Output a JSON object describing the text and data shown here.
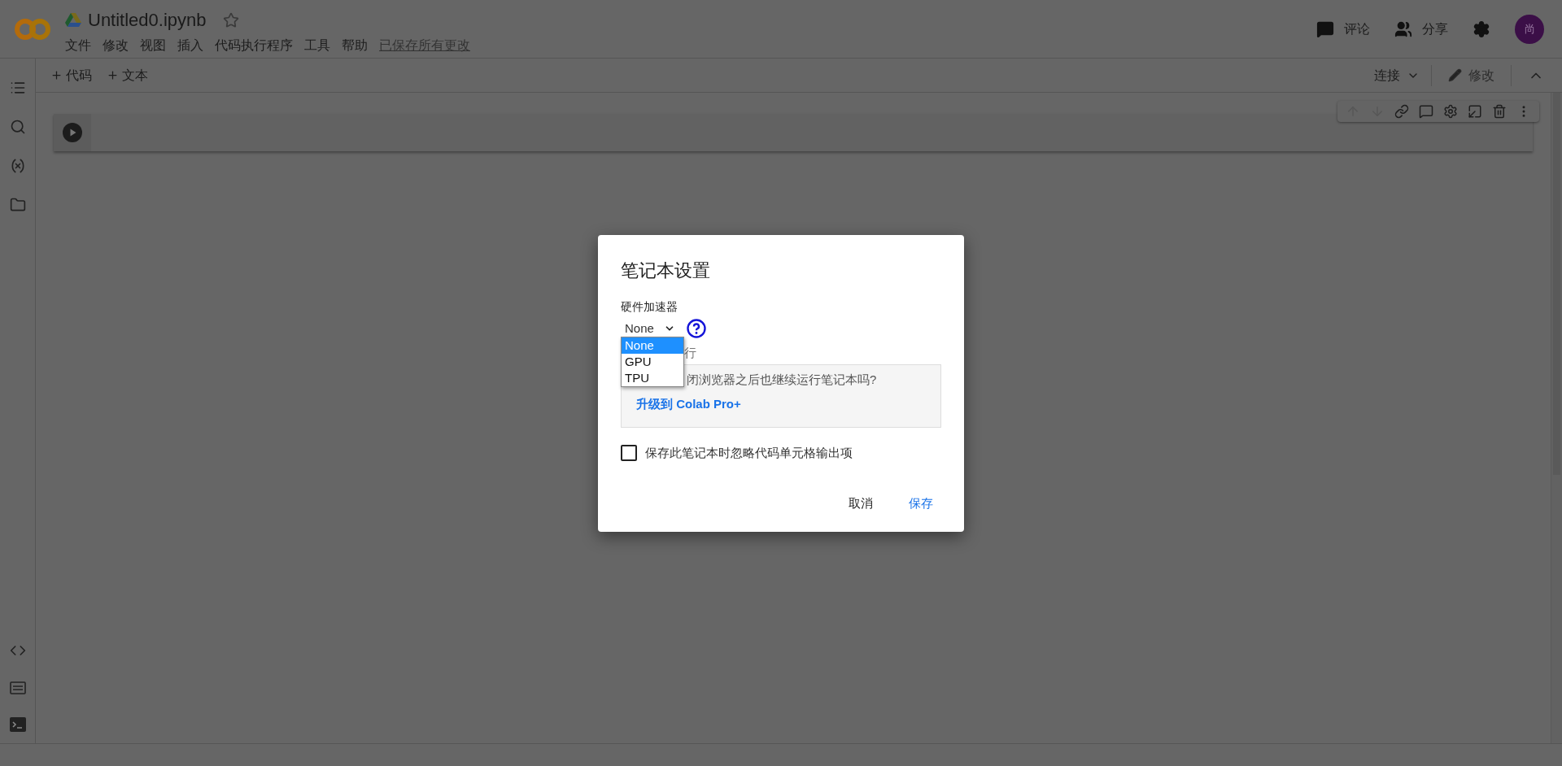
{
  "header": {
    "title": "Untitled0.ipynb",
    "starred": false,
    "menu": [
      "文件",
      "修改",
      "视图",
      "插入",
      "代码执行程序",
      "工具",
      "帮助"
    ],
    "save_status": "已保存所有更改",
    "actions": [
      {
        "label": "评论",
        "kind": "comment"
      },
      {
        "label": "分享",
        "kind": "share"
      }
    ],
    "avatar": "尚"
  },
  "toolbar": {
    "add_buttons": [
      "代码",
      "文本"
    ],
    "connect": "连接",
    "edit": "修改"
  },
  "cell_toolbar": [
    {
      "kind": "up",
      "disabled": true
    },
    {
      "kind": "down",
      "disabled": true
    },
    {
      "kind": "link",
      "disabled": false
    },
    {
      "kind": "comment",
      "disabled": false
    },
    {
      "kind": "settings",
      "disabled": false
    },
    {
      "kind": "mirror",
      "disabled": false
    },
    {
      "kind": "delete",
      "disabled": false
    },
    {
      "kind": "more",
      "disabled": false
    }
  ],
  "dialog": {
    "title": "笔记本设置",
    "accelerator_label": "硬件加速器",
    "accelerator_value": "None",
    "options": [
      {
        "label": "None",
        "selected": true
      },
      {
        "label": "GPU",
        "selected": false
      },
      {
        "label": "TPU",
        "selected": false
      }
    ],
    "background_label_fragment": "行",
    "pro_prompt_fragment": "闭浏览器之后也继续运行笔记本吗?",
    "upgrade_link": "升级到 Colab Pro+",
    "omit_output": {
      "label": "保存此笔记本时忽略代码单元格输出项",
      "checked": false
    },
    "buttons": [
      {
        "label": "取消",
        "kind": "cancel"
      },
      {
        "label": "保存",
        "kind": "save"
      }
    ]
  }
}
